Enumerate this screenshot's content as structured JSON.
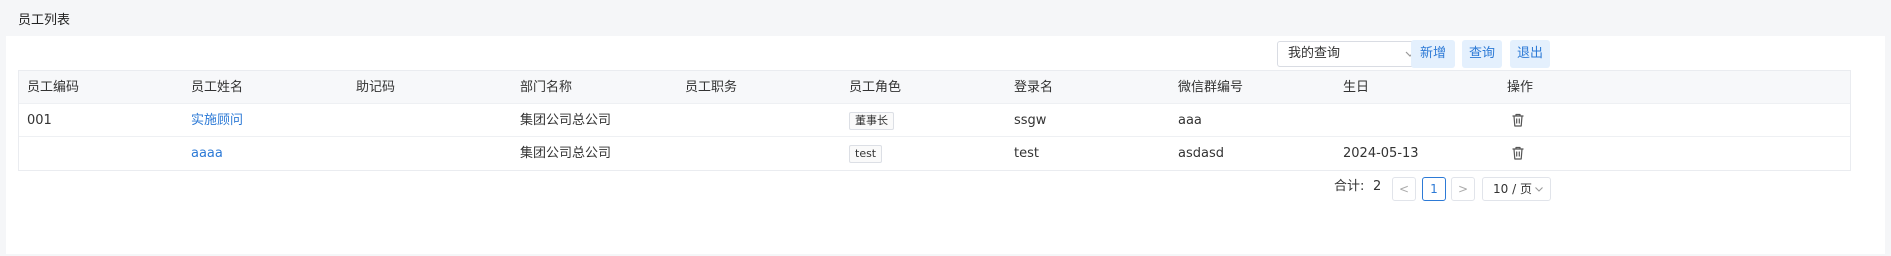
{
  "page": {
    "title": "员工列表"
  },
  "toolbar": {
    "query_select_value": "我的查询",
    "add_label": "新增",
    "search_label": "查询",
    "exit_label": "退出"
  },
  "table": {
    "columns": [
      "员工编码",
      "员工姓名",
      "助记码",
      "部门名称",
      "员工职务",
      "员工角色",
      "登录名",
      "微信群编号",
      "生日",
      "操作"
    ],
    "rows": [
      {
        "code": "001",
        "name": "实施顾问",
        "mnemonic": "",
        "department": "集团公司总公司",
        "position": "",
        "role": "董事长",
        "login": "ssgw",
        "wechat_group": "aaa",
        "birthday": ""
      },
      {
        "code": "",
        "name": "aaaa",
        "mnemonic": "",
        "department": "集团公司总公司",
        "position": "",
        "role": "test",
        "login": "test",
        "wechat_group": "asdasd",
        "birthday": "2024-05-13"
      }
    ]
  },
  "pagination": {
    "total_label": "合计:",
    "total": "2",
    "prev": "<",
    "current_page": "1",
    "next": ">",
    "page_size": "10 / 页"
  },
  "colors": {
    "accent": "#2d7ad6",
    "button_bg": "#e4f0fd"
  },
  "icons": {
    "delete": "trash-icon",
    "dropdown": "chevron-down-icon"
  }
}
